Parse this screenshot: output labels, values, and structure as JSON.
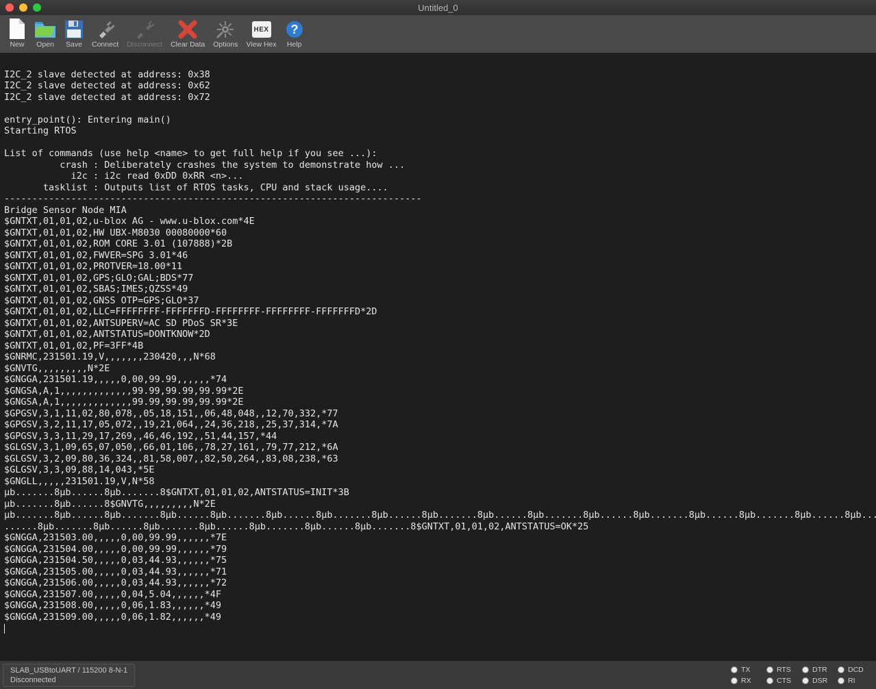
{
  "window": {
    "title": "Untitled_0"
  },
  "toolbar": [
    {
      "name": "new-button",
      "label": "New",
      "icon": "file",
      "enabled": true
    },
    {
      "name": "open-button",
      "label": "Open",
      "icon": "folder",
      "enabled": true
    },
    {
      "name": "save-button",
      "label": "Save",
      "icon": "floppy",
      "enabled": true
    },
    {
      "name": "connect-button",
      "label": "Connect",
      "icon": "plug",
      "enabled": true
    },
    {
      "name": "disconnect-button",
      "label": "Disconnect",
      "icon": "plug-off",
      "enabled": false
    },
    {
      "name": "clear-button",
      "label": "Clear Data",
      "icon": "clear",
      "enabled": true
    },
    {
      "name": "options-button",
      "label": "Options",
      "icon": "gear",
      "enabled": true
    },
    {
      "name": "viewhex-button",
      "label": "View Hex",
      "icon": "hex",
      "enabled": true
    },
    {
      "name": "help-button",
      "label": "Help",
      "icon": "help",
      "enabled": true
    }
  ],
  "terminal_lines": [
    "",
    "I2C_2 slave detected at address: 0x38",
    "I2C_2 slave detected at address: 0x62",
    "I2C_2 slave detected at address: 0x72",
    "",
    "entry_point(): Entering main()",
    "Starting RTOS",
    "",
    "List of commands (use help <name> to get full help if you see ...):",
    "          crash : Deliberately crashes the system to demonstrate how ...",
    "            i2c : i2c read 0xDD 0xRR <n>...",
    "       tasklist : Outputs list of RTOS tasks, CPU and stack usage....",
    "---------------------------------------------------------------------------",
    "Bridge Sensor Node MIA",
    "$GNTXT,01,01,02,u-blox AG - www.u-blox.com*4E",
    "$GNTXT,01,01,02,HW UBX-M8030 00080000*60",
    "$GNTXT,01,01,02,ROM CORE 3.01 (107888)*2B",
    "$GNTXT,01,01,02,FWVER=SPG 3.01*46",
    "$GNTXT,01,01,02,PROTVER=18.00*11",
    "$GNTXT,01,01,02,GPS;GLO;GAL;BDS*77",
    "$GNTXT,01,01,02,SBAS;IMES;QZSS*49",
    "$GNTXT,01,01,02,GNSS OTP=GPS;GLO*37",
    "$GNTXT,01,01,02,LLC=FFFFFFFF-FFFFFFFD-FFFFFFFF-FFFFFFFF-FFFFFFFD*2D",
    "$GNTXT,01,01,02,ANTSUPERV=AC SD PDoS SR*3E",
    "$GNTXT,01,01,02,ANTSTATUS=DONTKNOW*2D",
    "$GNTXT,01,01,02,PF=3FF*4B",
    "$GNRMC,231501.19,V,,,,,,,230420,,,N*68",
    "$GNVTG,,,,,,,,,N*2E",
    "$GNGGA,231501.19,,,,,0,00,99.99,,,,,,*74",
    "$GNGSA,A,1,,,,,,,,,,,,,99.99,99.99,99.99*2E",
    "$GNGSA,A,1,,,,,,,,,,,,,99.99,99.99,99.99*2E",
    "$GPGSV,3,1,11,02,80,078,,05,18,151,,06,48,048,,12,70,332,*77",
    "$GPGSV,3,2,11,17,05,072,,19,21,064,,24,36,218,,25,37,314,*7A",
    "$GPGSV,3,3,11,29,17,269,,46,46,192,,51,44,157,*44",
    "$GLGSV,3,1,09,65,07,050,,66,01,106,,78,27,161,,79,77,212,*6A",
    "$GLGSV,3,2,09,80,36,324,,81,58,007,,82,50,264,,83,08,238,*63",
    "$GLGSV,3,3,09,88,14,043,*5E",
    "$GNGLL,,,,,231501.19,V,N*58",
    "µb.......8µb......8µb.......8$GNTXT,01,01,02,ANTSTATUS=INIT*3B",
    "µb.......8µb......8$GNVTG,,,,,,,,,N*2E",
    "µb.......8µb......8µb.......8µb......8µb.......8µb......8µb.......8µb......8µb.......8µb......8µb.......8µb......8µb.......8µb......8µb.......8µb......8µb.......8µb",
    "......8µb.......8µb......8µb.......8µb......8µb.......8µb......8µb.......8$GNTXT,01,01,02,ANTSTATUS=OK*25",
    "$GNGGA,231503.00,,,,,0,00,99.99,,,,,,*7E",
    "$GNGGA,231504.00,,,,,0,00,99.99,,,,,,*79",
    "$GNGGA,231504.50,,,,,0,03,44.93,,,,,,*75",
    "$GNGGA,231505.00,,,,,0,03,44.93,,,,,,*71",
    "$GNGGA,231506.00,,,,,0,03,44.93,,,,,,*72",
    "$GNGGA,231507.00,,,,,0,04,5.04,,,,,,*4F",
    "$GNGGA,231508.00,,,,,0,06,1.83,,,,,,*49",
    "$GNGGA,231509.00,,,,,0,06,1.82,,,,,,*49"
  ],
  "status": {
    "port": "SLAB_USBtoUART / 115200 8-N-1",
    "state": "Disconnected"
  },
  "leds": [
    [
      {
        "name": "TX"
      },
      {
        "name": "RX"
      }
    ],
    [
      {
        "name": "RTS"
      },
      {
        "name": "CTS"
      }
    ],
    [
      {
        "name": "DTR"
      },
      {
        "name": "DSR"
      }
    ],
    [
      {
        "name": "DCD"
      },
      {
        "name": "RI"
      }
    ]
  ]
}
